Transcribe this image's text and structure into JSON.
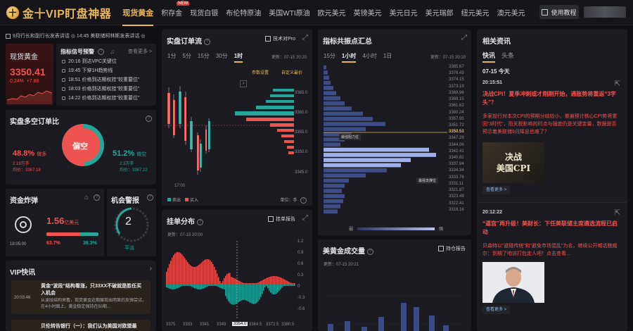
{
  "app": {
    "logo_letter": "十",
    "title": "金十VIP盯盘神器",
    "tutorial": "使用教程"
  },
  "nav": {
    "items": [
      "现货黄金",
      "积存金",
      "现货白银",
      "布伦特原油",
      "美国WTI原油",
      "欧元美元",
      "英镑美元",
      "美元日元",
      "美元瑞郎",
      "纽元美元",
      "澳元美元"
    ],
    "badge": "NEW"
  },
  "ticker": "9月行长和副行长发表讲话 ◎ 14:45 美联储柯林斯发表讲话 ◎",
  "gold_card": {
    "name": "现货黄金",
    "price": "3350.41",
    "change_pct": "0.24%",
    "change_abs": "+7.88"
  },
  "signals": {
    "title": "指标信号预警",
    "more": "查看更多 >",
    "rows": [
      {
        "time": "20:16",
        "text": "到达VPC关键位"
      },
      {
        "time": "19:45",
        "text": "下穿1H趋势线"
      },
      {
        "time": "18:51",
        "text": "价格到达期权挂\"较重要位\""
      },
      {
        "time": "18:03",
        "text": "价格到达期权挂\"较重要位\""
      },
      {
        "time": "14:22",
        "text": "价格到达期权挂\"较重要位\""
      }
    ]
  },
  "long_short": {
    "title": "实盘多空订单比",
    "center": "偏空",
    "long_pct": "48.8%",
    "long_label": "做多",
    "long_hands": "2.19万手",
    "long_avg": "均价：3367.18",
    "short_pct": "51.2%",
    "short_label": "做空",
    "short_hands": "2.3万手",
    "short_avg": "均价：3367.22"
  },
  "capital": {
    "title": "资金炸弹",
    "amount": "1.56",
    "unit": "亿美元",
    "time": "18:05:00",
    "red_pct": "63.7%",
    "green_pct": "36.3%",
    "red_share": 0.637
  },
  "machine": {
    "title": "机会警报",
    "level": "2",
    "status": "平淡"
  },
  "vip": {
    "title": "VIP快讯",
    "items": [
      {
        "time": "20:03:46",
        "title": "黄金“波段”结构看涨，只33XX不破就是胜任买入机会",
        "body": "从波段结构来看，现货黄金近期展现出明显的反弹尝试，在4小时图上，黄金稳定保持在50期..."
      },
      {
        "title": "贝伦转告银行（一）：我们认为美国对欧盟最"
      }
    ]
  },
  "order_flow": {
    "title": "实盘订单流",
    "link": "技术对Pro",
    "tabs": [
      "1分",
      "5分",
      "15分",
      "30分",
      "1时"
    ],
    "active_tab": 4,
    "updated": "更新：07-15 20:20",
    "param": "参数设置",
    "custom": "自定义最价",
    "time_label": "17:00",
    "legend_sell": "卖出",
    "legend_buy": "买入",
    "unit": "单位：手",
    "price_ticks": [
      "3365.0",
      "3360.0",
      "3355.0",
      "3350.0",
      "3345.0"
    ],
    "current_price": "3350.41"
  },
  "order_dist": {
    "title": "挂单分布",
    "link": "挂单报告",
    "updated": "更新：07-15 20:00",
    "price_label": "3354.0",
    "y_ticks": [
      "1.2",
      "0.9",
      "0.6",
      "0.3",
      "0",
      "-0.3",
      "-0.6"
    ],
    "x_ticks": [
      "3375",
      "3333",
      "3341",
      "3349",
      "3354.0",
      "3364.5",
      "3372.5",
      "3380.5"
    ]
  },
  "indicators": {
    "title": "指标共振点汇总",
    "tabs": [
      "15分",
      "1小时",
      "4小时",
      "1日"
    ],
    "active_tab": 1,
    "updated": "更新：07-15 20:19",
    "ticks": [
      "3385.67",
      "3376.43",
      "3374.15",
      "3373.19",
      "3369.96",
      "3369.15",
      "3361.62",
      "3360.24",
      "3357.95",
      "3351.72",
      "3350.53",
      "3347.29",
      "3344.06",
      "3342.41",
      "3340.82",
      "3337.94",
      "3334.34",
      "3333.76",
      "3331.11",
      "3321.87",
      "3323.49",
      "3322.41",
      "3318.16"
    ],
    "resistance": "最强阻力位",
    "support": "最强支撑位",
    "legend_low": "弱",
    "legend_high": "强"
  },
  "gold_position": {
    "title": "美黄金成交量",
    "link": "持仓报告",
    "updated": "更新：07-15 20:21"
  },
  "news": {
    "title": "相关资讯",
    "tabs": [
      "快讯",
      "头条"
    ],
    "date": "07-15 今天",
    "items": [
      {
        "time": "20:15:51",
        "title": "决战CPI！夏季冲刺或才刚刚开始，通胀势将重返“3字头”？",
        "body": "多家投行对本次CPI的预期分歧较小，普遍预计核心CPI势将重回“3时代”，而关税影响的时点与强度仍是关键变量，数据是否预示着美联储9月降息也难了？",
        "img": "决战\n美国CPI",
        "more": "查看更多 >"
      },
      {
        "time": "20:12:22",
        "title": "“逼宫”再升级！美财长：下任美联储主席遴选流程已启动",
        "body": "贝森特以“避碰传统”和“避免市场混乱”为名，继续公开喊话鲍威尔：到期了咱该打包走人吧！点击查看...",
        "more": "查看更多 >"
      }
    ]
  }
}
